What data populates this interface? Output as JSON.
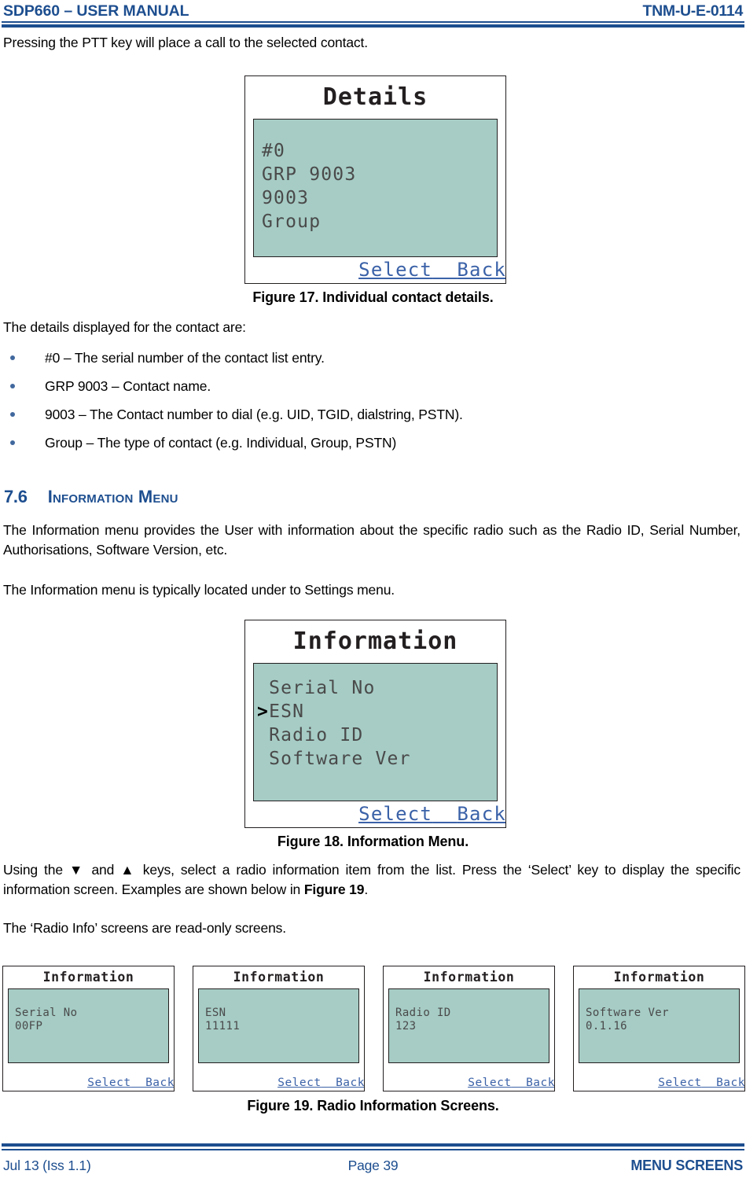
{
  "header": {
    "left": "SDP660 – USER MANUAL",
    "right": "TNM-U-E-0114"
  },
  "intro_paragraph": "Pressing the PTT key will place a call to the selected contact.",
  "figure17": {
    "screen": {
      "title": "Details",
      "lines": [
        "#0",
        "GRP 9003",
        "9003",
        "Group"
      ],
      "softkey_select": "Select",
      "softkey_back": "Back"
    },
    "caption": "Figure 17.  Individual contact details."
  },
  "details_intro": "The details displayed for the contact are:",
  "bullets": [
    "#0 – The serial number of the contact list entry.",
    "GRP 9003 – Contact name.",
    "9003 – The Contact number to dial (e.g. UID, TGID, dialstring, PSTN).",
    "Group – The type of contact (e.g. Individual, Group, PSTN)"
  ],
  "section": {
    "number": "7.6",
    "title": "Information Menu"
  },
  "section_paragraphs": [
    "The Information menu provides the User with information about the specific radio such as the Radio ID, Serial Number, Authorisations, Software Version, etc.",
    "The Information menu is typically located under to Settings menu."
  ],
  "figure18": {
    "screen": {
      "title": "Information",
      "items": [
        {
          "cursor": " ",
          "label": "Serial No"
        },
        {
          "cursor": ">",
          "label": "ESN"
        },
        {
          "cursor": " ",
          "label": "Radio ID"
        },
        {
          "cursor": " ",
          "label": "Software Ver"
        }
      ],
      "softkey_select": "Select",
      "softkey_back": "Back"
    },
    "caption": "Figure 18.  Information Menu."
  },
  "usage_paragraph_part1": "Using the ",
  "usage_down_arrow": "▼",
  "usage_paragraph_part2": " and ",
  "usage_up_arrow": "▲",
  "usage_paragraph_part3": " keys, select a radio information item from the list.  Press the ‘Select’ key to display the specific information screen.  Examples are shown below in ",
  "usage_figure_ref": "Figure 19",
  "usage_paragraph_part4": ".",
  "readonly_paragraph": "The ‘Radio Info’ screens are read-only screens.",
  "figure19": {
    "screens": [
      {
        "title": "Information",
        "label": "Serial No",
        "value": "00FP",
        "softkey_select": "Select",
        "softkey_back": "Back"
      },
      {
        "title": "Information",
        "label": "ESN",
        "value": "11111",
        "softkey_select": "Select",
        "softkey_back": "Back"
      },
      {
        "title": "Information",
        "label": "Radio ID",
        "value": "123",
        "softkey_select": "Select",
        "softkey_back": "Back"
      },
      {
        "title": "Information",
        "label": "Software Ver",
        "value": "0.1.16",
        "softkey_select": "Select",
        "softkey_back": "Back"
      }
    ],
    "caption": "Figure 19.  Radio Information Screens."
  },
  "footer": {
    "left": "Jul 13 (Iss 1.1)",
    "center": "Page 39",
    "right": "MENU SCREENS"
  },
  "colors": {
    "brand_blue": "#1d4e8f",
    "lcd_green": "#a6ccc5",
    "softkey_blue": "#3b62a8",
    "lcd_text": "#4a4a4a"
  }
}
